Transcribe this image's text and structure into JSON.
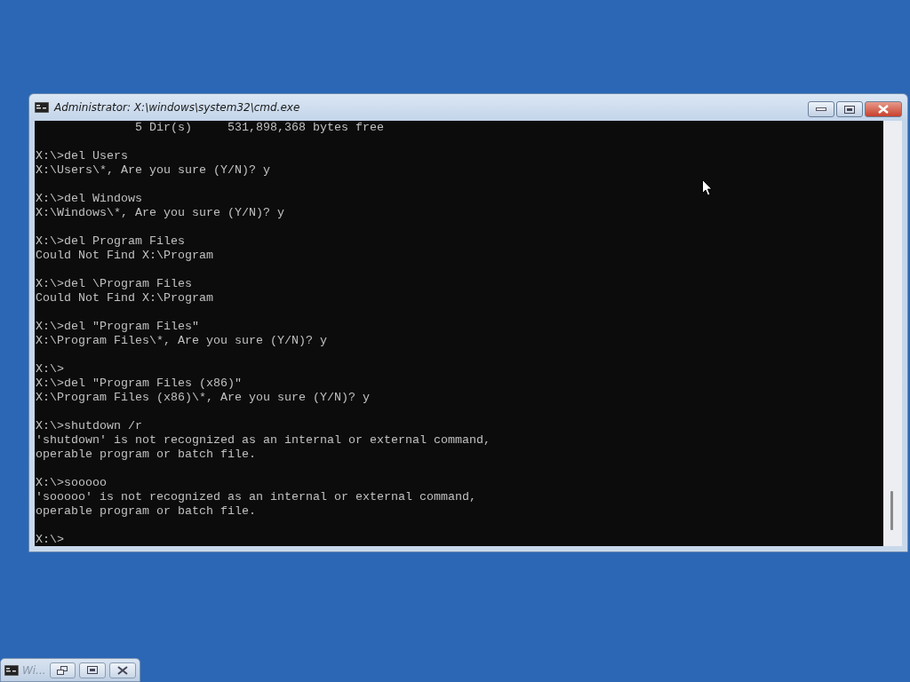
{
  "window": {
    "title": "Administrator: X:\\windows\\system32\\cmd.exe"
  },
  "console": {
    "blocks": [
      [
        "              5 Dir(s)     531,898,368 bytes free"
      ],
      [
        "X:\\>del Users",
        "X:\\Users\\*, Are you sure (Y/N)? y"
      ],
      [
        "X:\\>del Windows",
        "X:\\Windows\\*, Are you sure (Y/N)? y"
      ],
      [
        "X:\\>del Program Files",
        "Could Not Find X:\\Program"
      ],
      [
        "X:\\>del \\Program Files",
        "Could Not Find X:\\Program"
      ],
      [
        "X:\\>del \"Program Files\"",
        "X:\\Program Files\\*, Are you sure (Y/N)? y"
      ],
      [
        "X:\\>",
        "X:\\>del \"Program Files (x86)\"",
        "X:\\Program Files (x86)\\*, Are you sure (Y/N)? y"
      ],
      [
        "X:\\>shutdown /r",
        "'shutdown' is not recognized as an internal or external command,",
        "operable program or batch file."
      ],
      [
        "X:\\>sooooo",
        "'sooooo' is not recognized as an internal or external command,",
        "operable program or batch file."
      ],
      [
        "X:\\>"
      ]
    ]
  },
  "minimized_window": {
    "title": "Wi..."
  }
}
